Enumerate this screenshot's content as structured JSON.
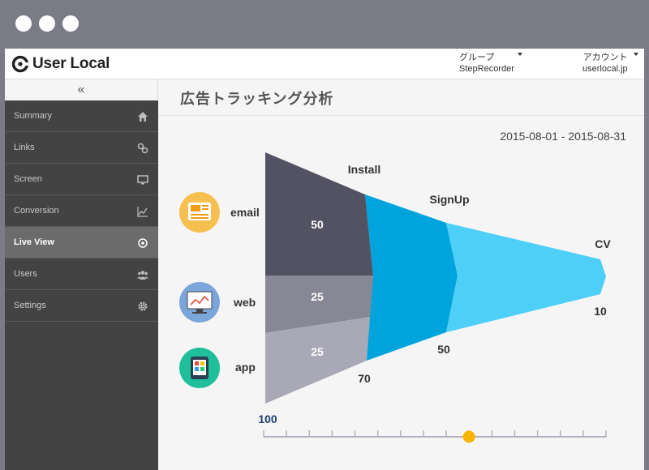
{
  "header": {
    "logo_text": "User Local",
    "group_label": "グループ",
    "group_value": "StepRecorder",
    "account_label": "アカウント",
    "account_value": "userlocal.jp"
  },
  "sidebar": {
    "collapse_label": "«",
    "items": [
      {
        "label": "Summary",
        "icon": "home-icon"
      },
      {
        "label": "Links",
        "icon": "link-icon"
      },
      {
        "label": "Screen",
        "icon": "monitor-icon"
      },
      {
        "label": "Conversion",
        "icon": "line-chart-icon"
      },
      {
        "label": "Live View",
        "icon": "target-icon",
        "active": true
      },
      {
        "label": "Users",
        "icon": "users-icon"
      },
      {
        "label": "Settings",
        "icon": "gear-icon"
      }
    ]
  },
  "main": {
    "title": "広告トラッキング分析",
    "date_range": "2015-08-01 - 2015-08-31"
  },
  "chart_data": {
    "type": "funnel",
    "stages": [
      "Install",
      "SignUp",
      "CV"
    ],
    "sources": [
      {
        "name": "email",
        "value": "50",
        "color": "#535263"
      },
      {
        "name": "web",
        "value": "25",
        "color": "#888796"
      },
      {
        "name": "app",
        "value": "25",
        "color": "#a9a8b6"
      }
    ],
    "totals": [
      "100",
      "70",
      "50",
      "10"
    ],
    "colors": {
      "signup": "#00a4dc",
      "cv": "#4ecff8"
    },
    "slider_value": 0.6
  }
}
